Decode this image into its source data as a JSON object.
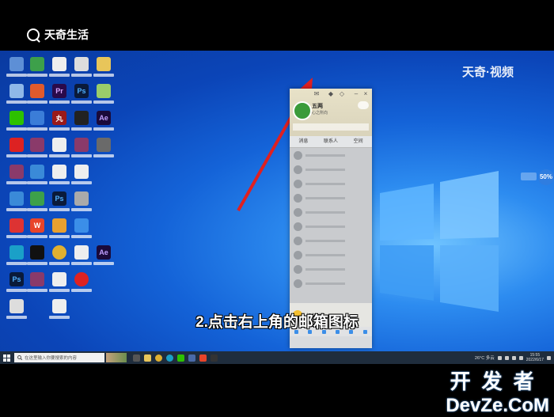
{
  "header": {
    "brand_name": "天奇生活"
  },
  "screen": {
    "watermark": "天奇·视频"
  },
  "qq_window": {
    "username": "五两",
    "status_text": "心之所向",
    "tabs": [
      "消息",
      "联系人",
      "空间"
    ],
    "bottom_item": "好友动态"
  },
  "widget": {
    "percent": "50%"
  },
  "subtitle": "2.点击右上角的邮箱图标",
  "taskbar": {
    "search_placeholder": "在这里输入你要搜索的内容",
    "weather": "26°C 多云",
    "time": "15:55",
    "date": "2022/6/17"
  },
  "corner_watermark": {
    "line1": "开发者",
    "line2": "DevZe.CoM"
  },
  "colors": {
    "accent_arrow": "#e02020",
    "desktop_blue": "#1463d8"
  }
}
